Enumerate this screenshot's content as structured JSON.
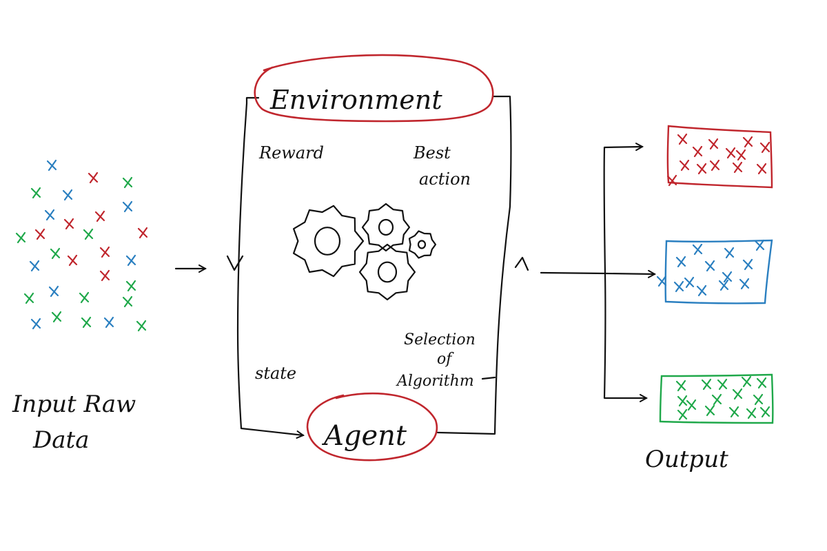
{
  "labels": {
    "environment": "Environment",
    "agent": "Agent",
    "reward": "Reward",
    "best_action_line1": "Best",
    "best_action_line2": "action",
    "state": "state",
    "selection_line1": "Selection",
    "selection_line2": "of",
    "selection_line3": "Algorithm",
    "input_line1": "Input Raw",
    "input_line2": "Data",
    "output": "Output"
  },
  "colors": {
    "ink": "#111111",
    "red": "#c0262d",
    "blue": "#2a7fc0",
    "green": "#1fa84a"
  },
  "icons": {
    "gears": "gears-icon"
  }
}
